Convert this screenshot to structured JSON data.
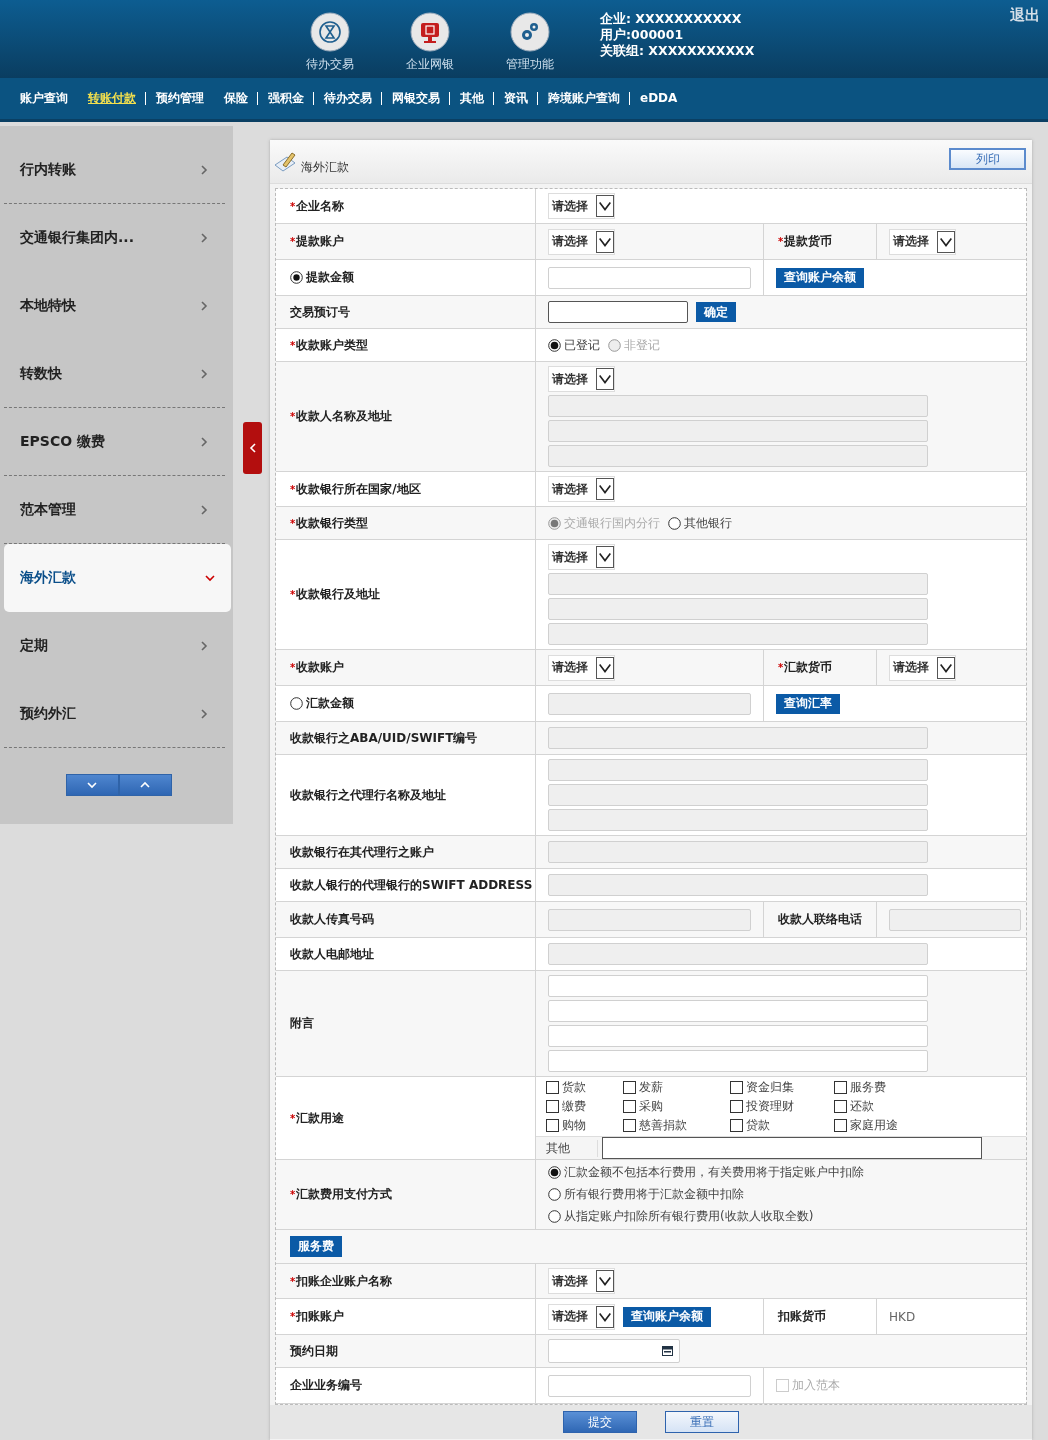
{
  "header": {
    "apps": [
      {
        "label": "待办交易"
      },
      {
        "label": "企业网银"
      },
      {
        "label": "管理功能"
      }
    ],
    "info": [
      "企业: XXXXXXXXXXX",
      "用户:000001",
      "关联组: XXXXXXXXXXX"
    ],
    "logout": "退出"
  },
  "nav": [
    {
      "label": "账户查询",
      "selected": false,
      "sep": false
    },
    {
      "label": "转账付款",
      "selected": true,
      "sep": true
    },
    {
      "label": "预约管理",
      "selected": false,
      "sep": false
    },
    {
      "label": "保险",
      "selected": false,
      "sep": true
    },
    {
      "label": "强积金",
      "selected": false,
      "sep": true
    },
    {
      "label": "待办交易",
      "selected": false,
      "sep": true
    },
    {
      "label": "网银交易",
      "selected": false,
      "sep": true
    },
    {
      "label": "其他",
      "selected": false,
      "sep": true
    },
    {
      "label": "资讯",
      "selected": false,
      "sep": true
    },
    {
      "label": "跨境账户查询",
      "selected": false,
      "sep": true
    },
    {
      "label": "eDDA",
      "selected": false,
      "sep": false
    }
  ],
  "sidebar": {
    "items": [
      {
        "label": "行内转账",
        "selected": false,
        "divider": true
      },
      {
        "label": "交通银行集团内...",
        "selected": false,
        "divider": false
      },
      {
        "label": "本地特快",
        "selected": false,
        "divider": false
      },
      {
        "label": "转数快",
        "selected": false,
        "divider": true
      },
      {
        "label": "EPSCO 缴费",
        "selected": false,
        "divider": true
      },
      {
        "label": "范本管理",
        "selected": false,
        "divider": true
      },
      {
        "label": "海外汇款",
        "selected": true,
        "divider": false
      },
      {
        "label": "定期",
        "selected": false,
        "divider": false
      },
      {
        "label": "预约外汇",
        "selected": false,
        "divider": true
      }
    ]
  },
  "panel": {
    "title": "海外汇款",
    "print": "列印",
    "rows": [
      {
        "kind": "inline",
        "label": {
          "text": "企业名称",
          "mark": "*"
        },
        "value": [
          {
            "kind": "select",
            "text": "请选择"
          }
        ]
      },
      {
        "kind": "split",
        "label": {
          "text": "提款账户",
          "mark": "*"
        },
        "value": [
          {
            "kind": "select",
            "text": "请选择"
          }
        ],
        "label2": {
          "text": "提款货币",
          "mark": "*"
        },
        "value2": [
          {
            "kind": "select",
            "text": "请选择"
          }
        ]
      },
      {
        "kind": "split",
        "label": {
          "text": "提款金额",
          "radio": {
            "selected": true
          }
        },
        "value": [
          {
            "kind": "input",
            "disabled": false
          }
        ],
        "value2": [
          {
            "kind": "button",
            "text": "查询账户余额"
          }
        ]
      },
      {
        "kind": "inline",
        "label": {
          "text": "交易预订号"
        },
        "value": [
          {
            "kind": "input",
            "disabled": false,
            "strong": true
          },
          {
            "kind": "button",
            "text": "确定"
          }
        ]
      },
      {
        "kind": "inline",
        "label": {
          "text": "收款账户类型",
          "mark": "*"
        },
        "value": [
          {
            "kind": "radio",
            "text": "已登记",
            "selected": true,
            "disabled": false
          },
          {
            "kind": "radio",
            "text": "非登记",
            "selected": false,
            "disabled": true
          }
        ]
      },
      {
        "kind": "stacked",
        "label": {
          "text": "收款人名称及地址",
          "mark": "*"
        },
        "value": [
          {
            "kind": "select",
            "text": "请选择"
          },
          {
            "kind": "input",
            "disabled": true
          },
          {
            "kind": "input",
            "disabled": true
          },
          {
            "kind": "input",
            "disabled": true
          }
        ]
      },
      {
        "kind": "inline",
        "label": {
          "text": "收款银行所在国家/地区",
          "mark": "*"
        },
        "value": [
          {
            "kind": "select",
            "text": "请选择"
          }
        ]
      },
      {
        "kind": "inline",
        "label": {
          "text": "收款银行类型",
          "mark": "*"
        },
        "value": [
          {
            "kind": "radio",
            "text": "交通银行国内分行",
            "selected": true,
            "disabled": true
          },
          {
            "kind": "radio",
            "text": "其他银行",
            "selected": false,
            "disabled": false
          }
        ]
      },
      {
        "kind": "stacked",
        "label": {
          "text": "收款银行及地址",
          "mark": "*"
        },
        "value": [
          {
            "kind": "select",
            "text": "请选择"
          },
          {
            "kind": "input",
            "disabled": true
          },
          {
            "kind": "input",
            "disabled": true
          },
          {
            "kind": "input",
            "disabled": true
          }
        ]
      },
      {
        "kind": "split",
        "label": {
          "text": "收款账户",
          "mark": "*"
        },
        "value": [
          {
            "kind": "select",
            "text": "请选择"
          }
        ],
        "label2": {
          "text": "汇款货币",
          "mark": "*"
        },
        "value2": [
          {
            "kind": "select",
            "text": "请选择"
          }
        ]
      },
      {
        "kind": "split",
        "label": {
          "text": "汇款金额",
          "radio": {
            "selected": false
          }
        },
        "value": [
          {
            "kind": "input",
            "disabled": true
          }
        ],
        "value2": [
          {
            "kind": "button",
            "text": "查询汇率"
          }
        ]
      },
      {
        "kind": "inline",
        "label": {
          "text": "收款银行之ABA/UID/SWIFT编号"
        },
        "value": [
          {
            "kind": "input",
            "disabled": true
          }
        ]
      },
      {
        "kind": "stacked",
        "label": {
          "text": "收款银行之代理行名称及地址"
        },
        "value": [
          {
            "kind": "input",
            "disabled": true
          },
          {
            "kind": "input",
            "disabled": true
          },
          {
            "kind": "input",
            "disabled": true
          }
        ]
      },
      {
        "kind": "inline",
        "label": {
          "text": "收款银行在其代理行之账户"
        },
        "value": [
          {
            "kind": "input",
            "disabled": true
          }
        ]
      },
      {
        "kind": "inline",
        "label": {
          "text": "收款人银行的代理银行的SWIFT ADDRESS"
        },
        "value": [
          {
            "kind": "input",
            "disabled": true
          }
        ]
      },
      {
        "kind": "split",
        "label": {
          "text": "收款人传真号码"
        },
        "value": [
          {
            "kind": "input",
            "disabled": true
          }
        ],
        "label2": {
          "text": "收款人联络电话"
        },
        "value2": [
          {
            "kind": "input",
            "disabled": true
          }
        ]
      },
      {
        "kind": "inline",
        "label": {
          "text": "收款人电邮地址"
        },
        "value": [
          {
            "kind": "input",
            "disabled": true
          }
        ]
      },
      {
        "kind": "stacked",
        "label": {
          "text": "附言"
        },
        "value": [
          {
            "kind": "input",
            "disabled": false
          },
          {
            "kind": "input",
            "disabled": false
          },
          {
            "kind": "input",
            "disabled": false
          },
          {
            "kind": "input",
            "disabled": false
          }
        ]
      },
      {
        "kind": "purpose",
        "label": {
          "text": "汇款用途",
          "mark": "*"
        },
        "value": [
          {
            "kind": "checkbox",
            "text": "货款",
            "checked": false
          },
          {
            "kind": "checkbox",
            "text": "发薪",
            "checked": false
          },
          {
            "kind": "checkbox",
            "text": "资金归集",
            "checked": false
          },
          {
            "kind": "checkbox",
            "text": "服务费",
            "checked": false
          },
          {
            "kind": "checkbox",
            "text": "缴费",
            "checked": false
          },
          {
            "kind": "checkbox",
            "text": "采购",
            "checked": false
          },
          {
            "kind": "checkbox",
            "text": "投资理财",
            "checked": false
          },
          {
            "kind": "checkbox",
            "text": "还款",
            "checked": false
          },
          {
            "kind": "checkbox",
            "text": "购物",
            "checked": false
          },
          {
            "kind": "checkbox",
            "text": "慈善捐款",
            "checked": false
          },
          {
            "kind": "checkbox",
            "text": "贷款",
            "checked": false
          },
          {
            "kind": "checkbox",
            "text": "家庭用途",
            "checked": false
          }
        ],
        "other": {
          "label": "其他"
        }
      },
      {
        "kind": "fee",
        "label": {
          "text": "汇款费用支付方式",
          "mark": "*"
        },
        "value": [
          {
            "kind": "radio",
            "text": "汇款金额不包括本行费用，有关费用将于指定账户中扣除",
            "selected": true,
            "disabled": false
          },
          {
            "kind": "radio",
            "text": "所有银行费用将于汇款金额中扣除",
            "selected": false,
            "disabled": false
          },
          {
            "kind": "radio",
            "text": "从指定账户扣除所有银行费用(收款人收取全数)",
            "selected": false,
            "disabled": false
          }
        ]
      },
      {
        "kind": "section",
        "text": "服务费"
      },
      {
        "kind": "inline",
        "label": {
          "text": "扣账企业账户名称",
          "mark": "*"
        },
        "value": [
          {
            "kind": "select",
            "text": "请选择"
          }
        ]
      },
      {
        "kind": "split",
        "label": {
          "text": "扣账账户",
          "mark": "*"
        },
        "value": [
          {
            "kind": "select",
            "text": "请选择"
          },
          {
            "kind": "button",
            "text": "查询账户余额"
          }
        ],
        "label2": {
          "text": "扣账货币"
        },
        "value2": [
          {
            "kind": "text",
            "text": "HKD"
          }
        ]
      },
      {
        "kind": "inline",
        "label": {
          "text": "预约日期"
        },
        "value": [
          {
            "kind": "date"
          }
        ]
      },
      {
        "kind": "split",
        "label": {
          "text": "企业业务编号"
        },
        "value": [
          {
            "kind": "input",
            "disabled": false
          }
        ],
        "value2": [
          {
            "kind": "checkbox",
            "text": "加入范本",
            "checked": false,
            "faint": true
          }
        ]
      }
    ],
    "actions": [
      {
        "text": "提交",
        "primary": true
      },
      {
        "text": "重置",
        "primary": false
      }
    ]
  }
}
